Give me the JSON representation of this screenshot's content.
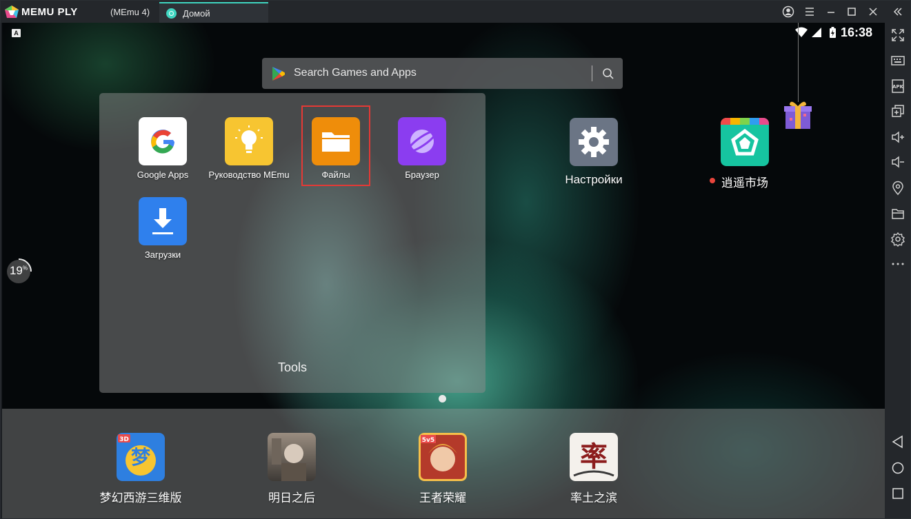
{
  "titlebar": {
    "brand_memu": "MEMU PL",
    "brand_play": "Y",
    "instance": "(MEmu 4)",
    "tab_label": "Домой",
    "buttons": [
      "user-icon",
      "menu-icon",
      "minimize-icon",
      "maximize-icon",
      "close-icon",
      "collapse-icon"
    ]
  },
  "status": {
    "input_badge": "A",
    "time": "16:38"
  },
  "search": {
    "placeholder": "Search Games and Apps"
  },
  "folder": {
    "name": "Tools",
    "apps": [
      {
        "label": "Google Apps",
        "icon": "google-icon"
      },
      {
        "label": "Руководство MEmu",
        "icon": "lightbulb-icon"
      },
      {
        "label": "Файлы",
        "icon": "folder-icon"
      },
      {
        "label": "Браузер",
        "icon": "planet-icon"
      },
      {
        "label": "Загрузки",
        "icon": "download-icon"
      }
    ]
  },
  "desktop": {
    "apps": [
      {
        "label": "Настройки",
        "icon": "gear-icon"
      },
      {
        "label": "逍遥市场",
        "icon": "market-icon"
      }
    ]
  },
  "progress": {
    "value": "19",
    "unit": "%"
  },
  "dock": {
    "apps": [
      {
        "label": "梦幻西游三维版",
        "icon": "game-dream-icon"
      },
      {
        "label": "明日之后",
        "icon": "game-tomorrow-icon"
      },
      {
        "label": "王者荣耀",
        "icon": "game-honor-icon"
      },
      {
        "label": "率土之滨",
        "icon": "game-land-icon"
      }
    ]
  },
  "sidebar": {
    "items": [
      "fullscreen-icon",
      "keyboard-icon",
      "apk-icon",
      "multi-window-icon",
      "volume-up-icon",
      "volume-down-icon",
      "location-icon",
      "files-icon",
      "settings-icon",
      "more-icon",
      "back-icon",
      "home-icon",
      "recents-icon"
    ]
  },
  "colors": {
    "accent": "#3fd6c1",
    "highlight": "#e53935",
    "titlebar": "#24272b"
  }
}
